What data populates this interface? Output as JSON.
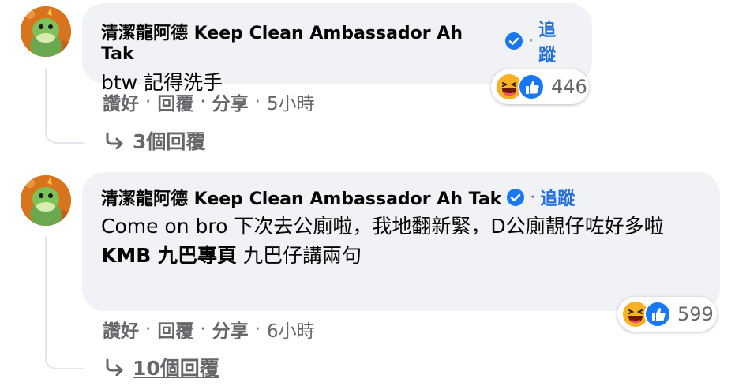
{
  "comments": [
    {
      "author": "清潔龍阿德 Keep Clean Ambassador Ah Tak",
      "follow_label": "追蹤",
      "separator": "·",
      "text": "btw 記得洗手",
      "mention": "",
      "text2": "",
      "actions": {
        "like": "讚好",
        "reply": "回覆",
        "share": "分享",
        "time": "5小時"
      },
      "reaction_count": "446",
      "replies_label": "3個回覆"
    },
    {
      "author": "清潔龍阿德 Keep Clean Ambassador Ah Tak",
      "follow_label": "追蹤",
      "separator": "·",
      "text": "Come on bro 下次去公廁啦，我地翻新緊，D公廁靚仔咗好多啦",
      "mention": "KMB 九巴專頁",
      "text2": "九巴仔講兩句",
      "actions": {
        "like": "讚好",
        "reply": "回覆",
        "share": "分享",
        "time": "6小時"
      },
      "reaction_count": "599",
      "replies_label": "10個回覆"
    }
  ],
  "icons": {
    "verified": "verified-badge-icon",
    "haha": "haha-reaction-icon",
    "like": "like-reaction-icon",
    "reply_arrow": "reply-arrow-icon",
    "avatar": "dragon-mascot-avatar"
  },
  "colors": {
    "accent": "#216fdb",
    "bubble": "#f0f2f5",
    "muted": "#65676b",
    "haha": "#f7b125",
    "like": "#1877f2"
  }
}
